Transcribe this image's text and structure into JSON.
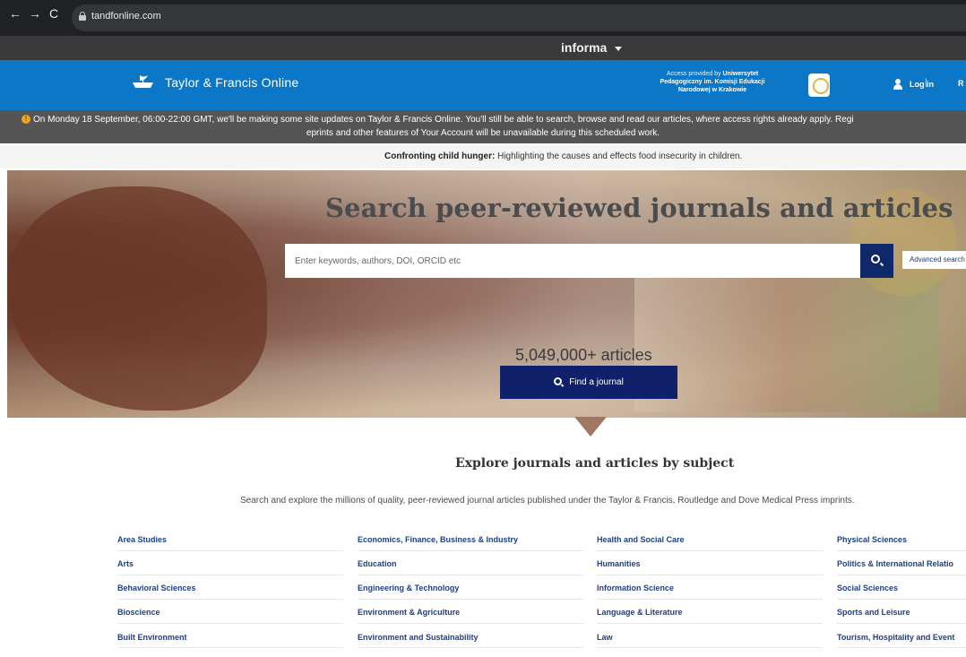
{
  "browser": {
    "back": "←",
    "forward": "→",
    "reload": "C",
    "url": "tandfonline.com"
  },
  "informa": {
    "label": "informa"
  },
  "header": {
    "logo_text": "Taylor & Francis Online",
    "access_line1": "Access provided by ",
    "access_inst1": "Uniwersytet",
    "access_inst2": "Pedagogiczny im. Komisji Edukacji",
    "access_inst3": "Narodowej w Krakowie",
    "login": "Log in",
    "separator": "|",
    "register_cut": "R"
  },
  "notice": {
    "icon": "!",
    "line1": "On Monday 18 September, 06:00-22:00 GMT, we'll be making some site updates on Taylor & Francis Online. You'll still be able to search, browse and read our articles, where access rights already apply. Regi",
    "line2": "eprints and other features of Your Account will be unavailable during this scheduled work."
  },
  "headline": {
    "bold": "Confronting child hunger:",
    "rest": " Highlighting the causes and effects food insecurity in children."
  },
  "hero": {
    "title": "Search peer-reviewed journals and articles",
    "search_placeholder": "Enter keywords, authors, DOI, ORCID etc",
    "advanced_search": "Advanced search",
    "article_count": "5,049,000+ articles",
    "find_journal": "Find a journal"
  },
  "subjects": {
    "title": "Explore journals and articles by subject",
    "subtitle": "Search and explore the millions of quality, peer-reviewed journal articles published under the Taylor & Francis, Routledge and Dove Medical Press imprints.",
    "items": [
      "Area Studies",
      "Arts",
      "Behavioral Sciences",
      "Bioscience",
      "Built Environment",
      "Economics, Finance, Business & Industry",
      "Education",
      "Engineering & Technology",
      "Environment & Agriculture",
      "Environment and Sustainability",
      "Health and Social Care",
      "Humanities",
      "Information Science",
      "Language & Literature",
      "Law",
      "Physical Sciences",
      "Politics & International Relatio",
      "Social Sciences",
      "Sports and Leisure",
      "Tourism, Hospitality and Event"
    ]
  },
  "colors": {
    "header_blue": "#0b77c6",
    "notice_gray": "#555555",
    "navy": "#0f2869",
    "link_blue": "#1e3f88",
    "warning": "#f4a61d"
  }
}
